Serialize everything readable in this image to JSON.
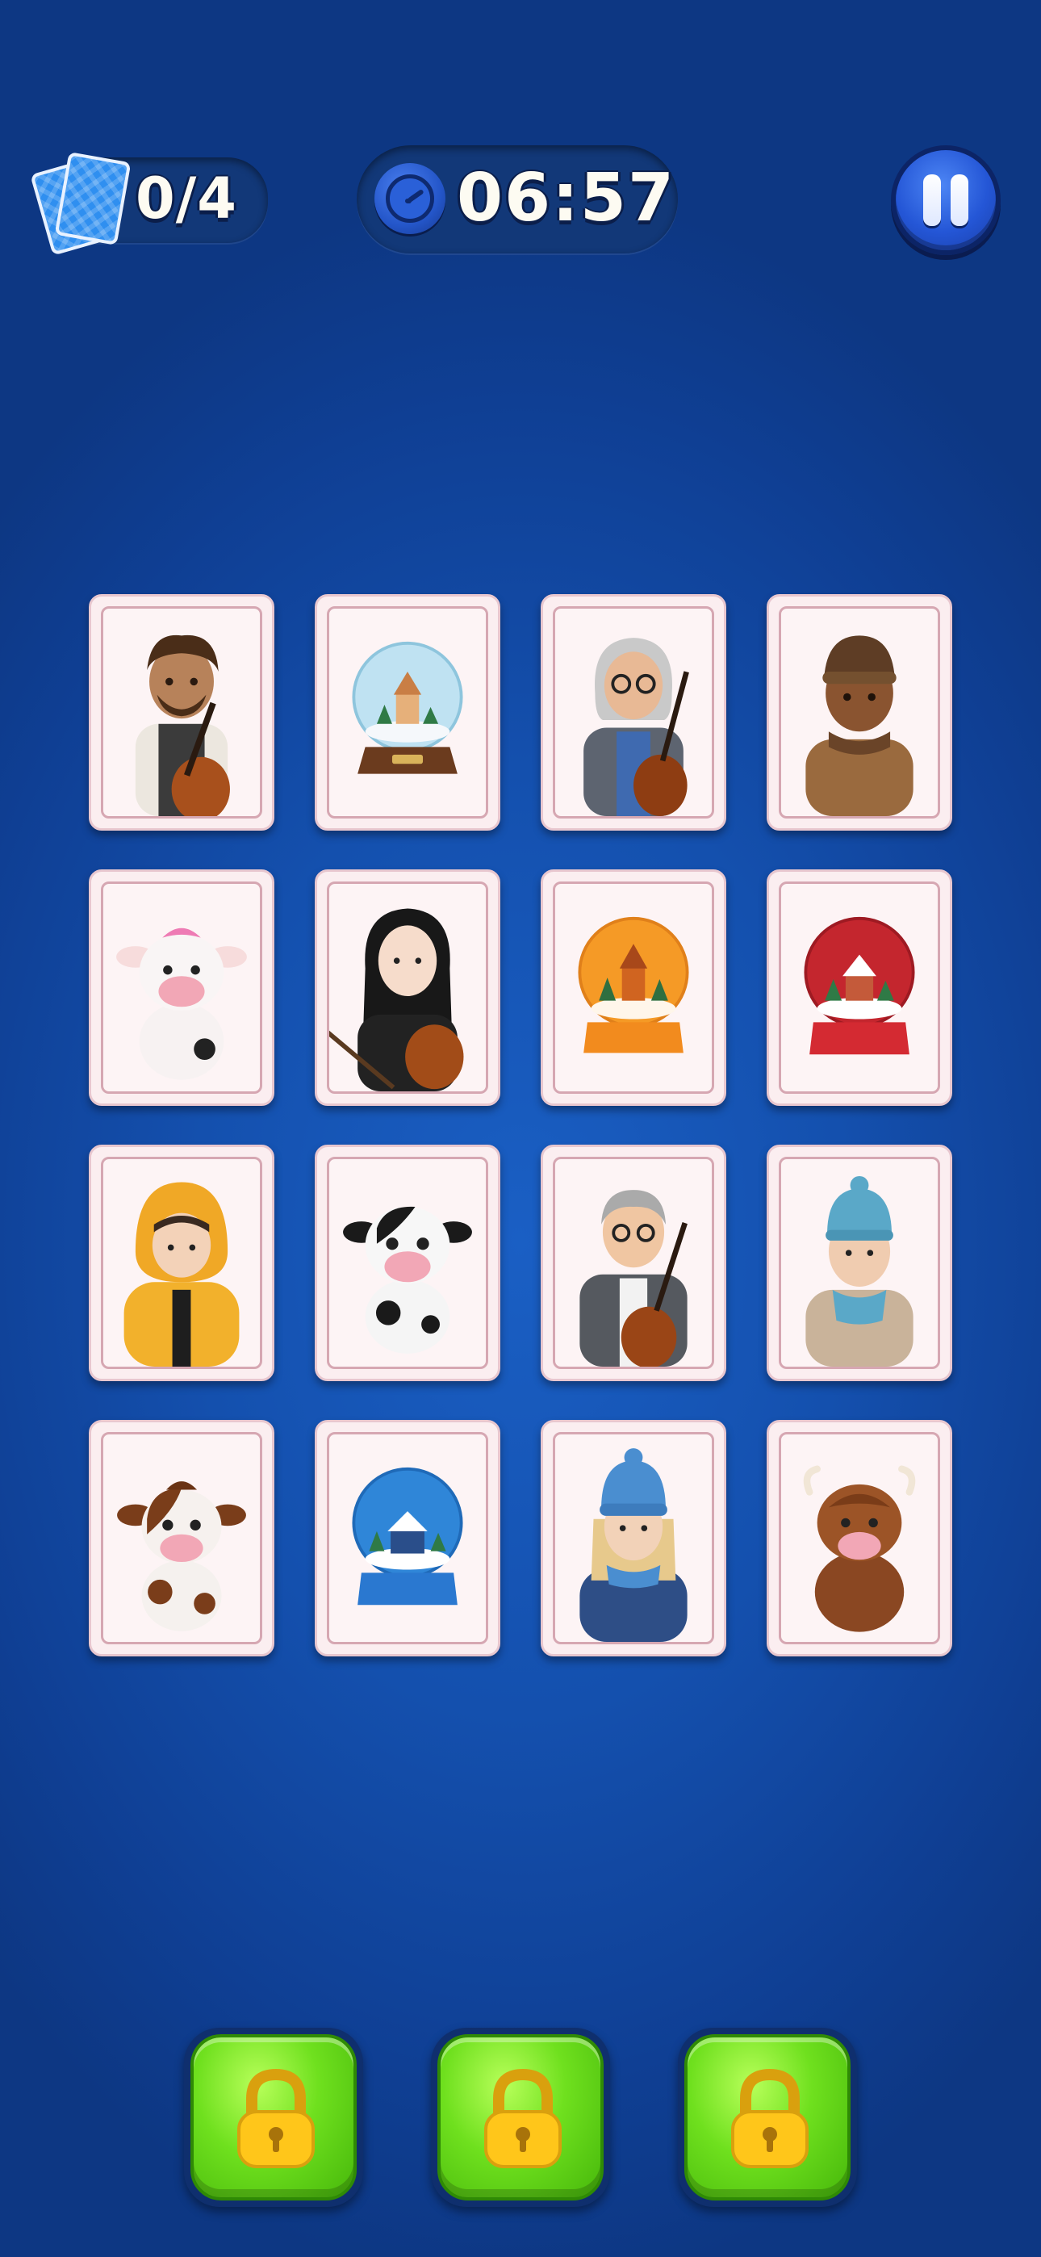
{
  "hud": {
    "matched_count": "0/4",
    "timer": "06:57"
  },
  "icons": {
    "deck": "card-deck-icon",
    "clock": "clock-icon",
    "pause": "pause-icon",
    "lock": "padlock-icon"
  },
  "colors": {
    "background": "#1450ae",
    "card_face": "#fbeef0",
    "lock_button": "#6fe01e"
  },
  "cards": [
    {
      "kind": "person",
      "subject": "man-with-cello"
    },
    {
      "kind": "globe",
      "subject": "snow-globe-chapel"
    },
    {
      "kind": "person",
      "subject": "grey-haired-woman-with-cello"
    },
    {
      "kind": "person",
      "subject": "man-in-beanie-and-scarf"
    },
    {
      "kind": "cow",
      "subject": "pink-tuft-cow"
    },
    {
      "kind": "person",
      "subject": "woman-with-violin"
    },
    {
      "kind": "globe",
      "subject": "orange-snow-globe"
    },
    {
      "kind": "globe",
      "subject": "red-snow-globe"
    },
    {
      "kind": "person",
      "subject": "child-in-yellow-parka"
    },
    {
      "kind": "cow",
      "subject": "black-and-white-cow"
    },
    {
      "kind": "person",
      "subject": "grey-haired-man-with-cello"
    },
    {
      "kind": "person",
      "subject": "old-man-in-blue-beanie"
    },
    {
      "kind": "cow",
      "subject": "brown-and-white-cow"
    },
    {
      "kind": "globe",
      "subject": "blue-snow-globe"
    },
    {
      "kind": "person",
      "subject": "blonde-woman-in-blue-beanie"
    },
    {
      "kind": "cow",
      "subject": "highland-cow"
    }
  ],
  "lock_slots": [
    {
      "state": "locked"
    },
    {
      "state": "locked"
    },
    {
      "state": "locked"
    }
  ]
}
